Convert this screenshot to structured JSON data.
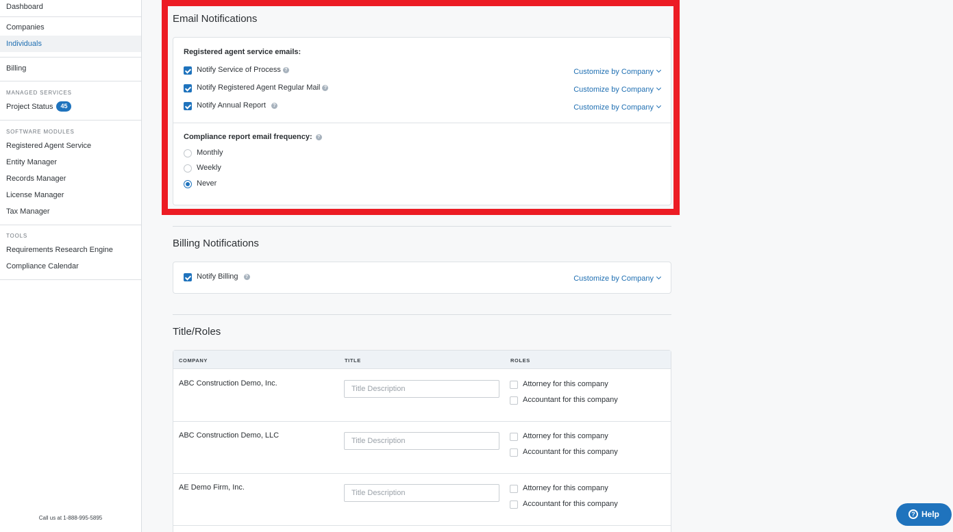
{
  "sidebar": {
    "items": [
      {
        "label": "Dashboard"
      },
      {
        "label": "Companies"
      },
      {
        "label": "Individuals"
      },
      {
        "label": "Billing"
      }
    ],
    "managed_services": {
      "heading": "MANAGED SERVICES",
      "project_status": "Project Status",
      "project_status_count": "45"
    },
    "software_modules": {
      "heading": "SOFTWARE MODULES",
      "items": [
        "Registered Agent Service",
        "Entity Manager",
        "Records Manager",
        "License Manager",
        "Tax Manager"
      ]
    },
    "tools": {
      "heading": "TOOLS",
      "items": [
        "Requirements Research Engine",
        "Compliance Calendar"
      ]
    },
    "call_text": "Call us at 1-888-995-5895"
  },
  "email_notifications": {
    "title": "Email Notifications",
    "ra_heading": "Registered agent service emails:",
    "options": [
      {
        "label": "Notify Service of Process",
        "checked": true,
        "customize": "Customize by Company"
      },
      {
        "label": "Notify Registered Agent Regular Mail",
        "checked": true,
        "customize": "Customize by Company"
      },
      {
        "label": "Notify Annual Report",
        "checked": true,
        "customize": "Customize by Company"
      }
    ],
    "frequency_heading": "Compliance report email frequency:",
    "frequency_options": [
      "Monthly",
      "Weekly",
      "Never"
    ],
    "frequency_selected": "Never"
  },
  "billing_notifications": {
    "title": "Billing Notifications",
    "option": {
      "label": "Notify Billing",
      "checked": true,
      "customize": "Customize by Company"
    }
  },
  "title_roles": {
    "title": "Title/Roles",
    "columns": [
      "COMPANY",
      "TITLE",
      "ROLES"
    ],
    "title_placeholder": "Title Description",
    "role_options": [
      "Attorney for this company",
      "Accountant for this company"
    ],
    "rows": [
      {
        "company": "ABC Construction Demo, Inc."
      },
      {
        "company": "ABC Construction Demo, LLC"
      },
      {
        "company": "AE Demo Firm, Inc."
      }
    ]
  },
  "help_button": "Help",
  "colors": {
    "accent": "#1f73bd",
    "highlight": "#ec1c24"
  }
}
